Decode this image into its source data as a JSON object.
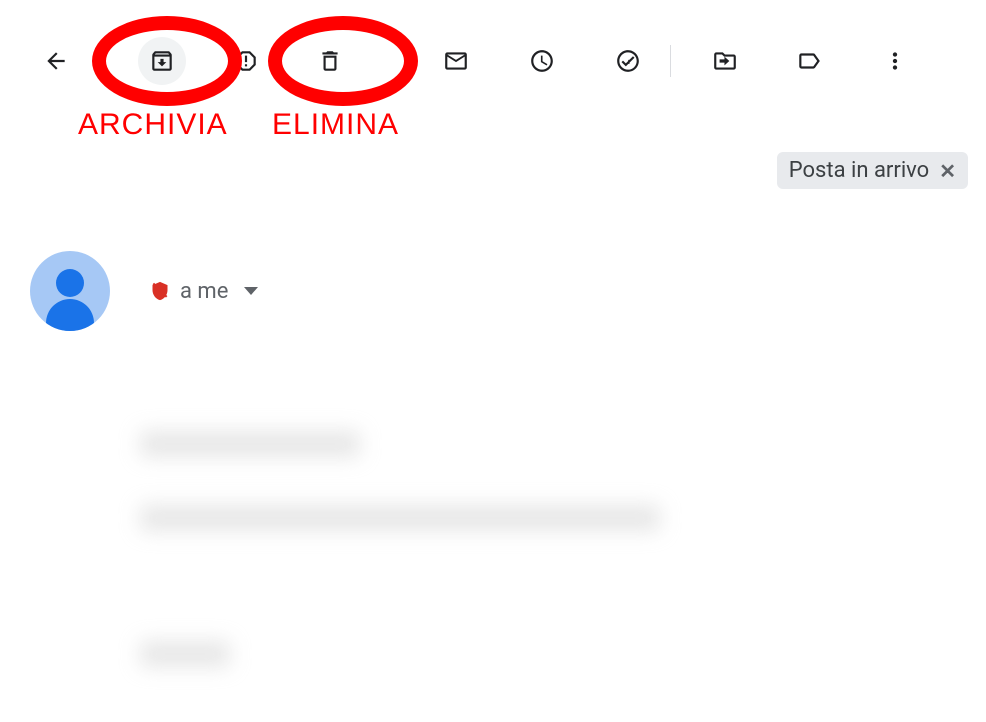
{
  "annotations": {
    "archive_label": "ARCHIVIA",
    "delete_label": "ELIMINA"
  },
  "toolbar": {
    "back": "Indietro",
    "archive": "Archivia",
    "spam": "Segnala spam",
    "delete": "Elimina",
    "mark_unread": "Segna come da leggere",
    "snooze": "Posticipa",
    "add_task": "Aggiungi ad Attività",
    "move_to": "Sposta in",
    "labels": "Etichette",
    "more": "Altro"
  },
  "labels": {
    "inbox": "Posta in arrivo"
  },
  "sender": {
    "recipient_text": "a me"
  }
}
